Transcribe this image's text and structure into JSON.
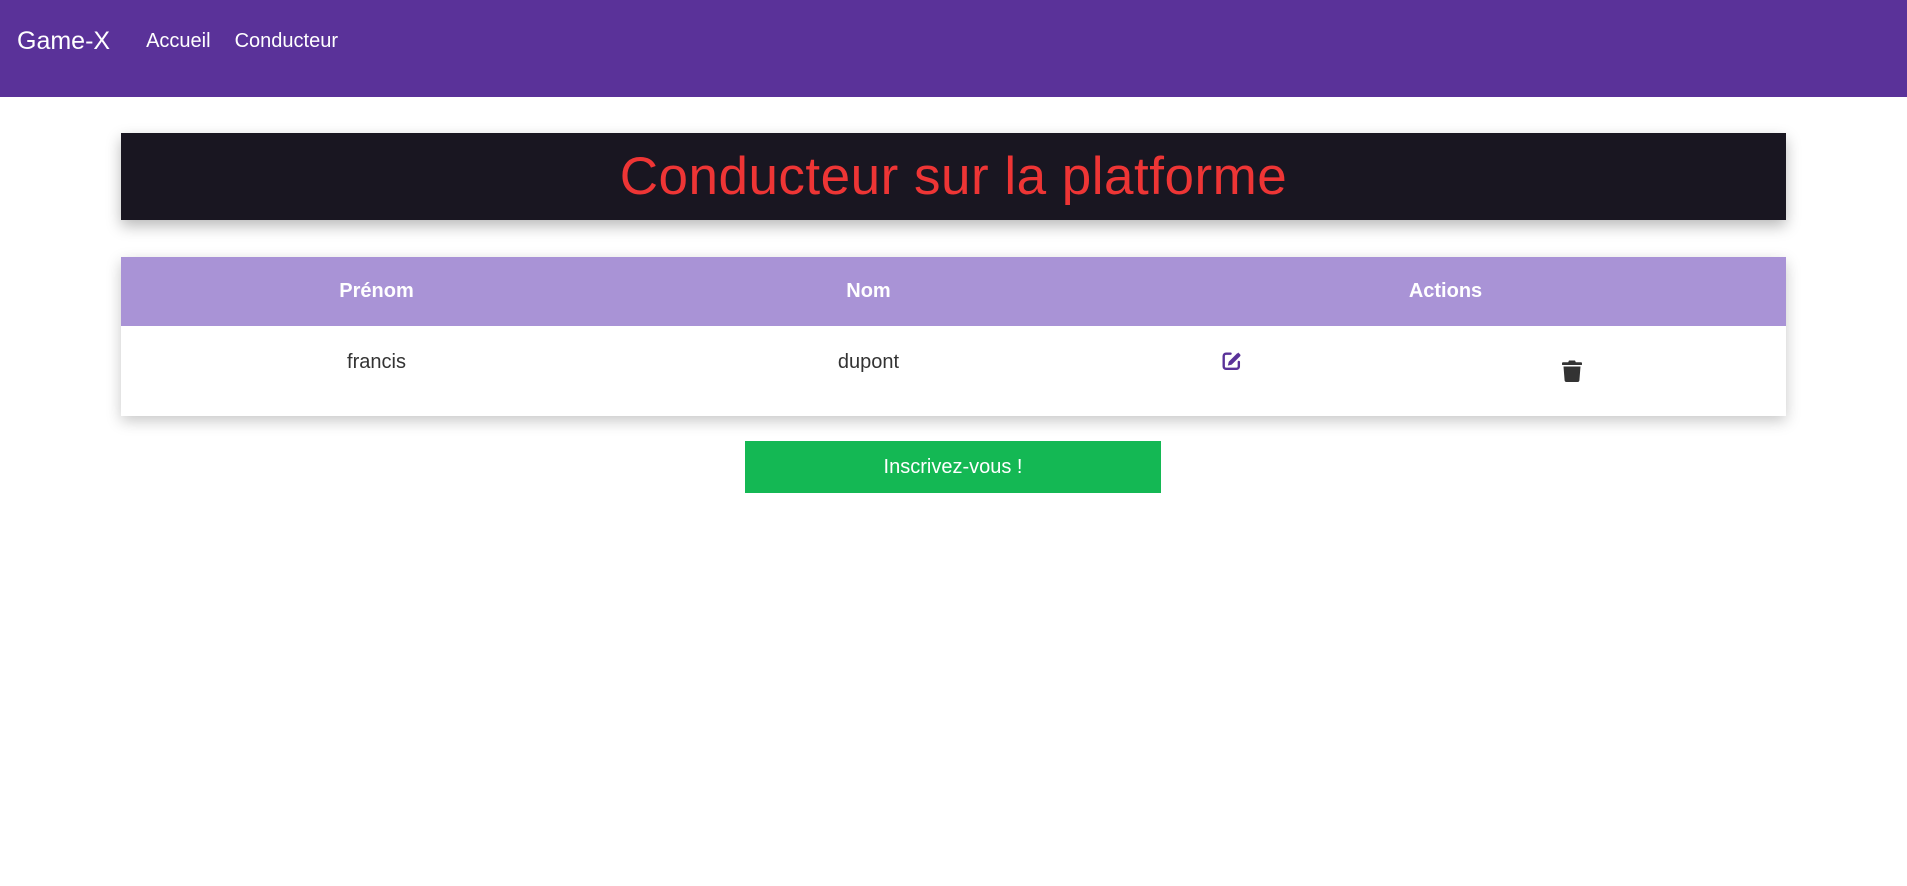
{
  "navbar": {
    "brand": "Game-X",
    "links": [
      {
        "label": "Accueil"
      },
      {
        "label": "Conducteur"
      }
    ],
    "background": "#5a3299"
  },
  "banner": {
    "title": "Conducteur sur la platforme",
    "title_color": "#ee3535",
    "background": "#191621"
  },
  "table": {
    "headers": [
      "Prénom",
      "Nom",
      "Actions"
    ],
    "header_background": "#a993d6",
    "rows": [
      {
        "prenom": "francis",
        "nom": "dupont",
        "actions": [
          {
            "icon": "edit-icon",
            "color": "#5a3299"
          },
          {
            "icon": "trash-icon",
            "color": "#333333"
          }
        ]
      }
    ]
  },
  "signup": {
    "label": "Inscrivez-vous !",
    "background": "#14b854"
  }
}
